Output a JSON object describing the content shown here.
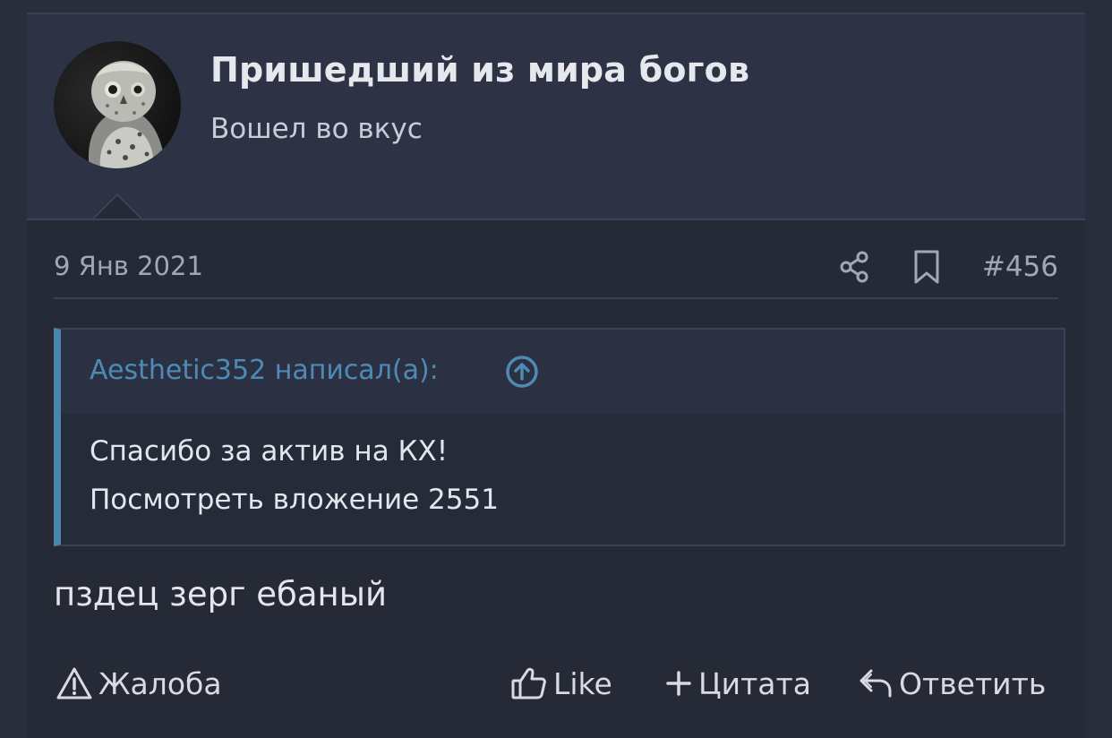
{
  "user": {
    "name": "Пришедший из мира богов",
    "title": "Вошел во вкус"
  },
  "post": {
    "date": "9 Янв 2021",
    "number": "#456",
    "quote": {
      "author": "Aesthetic352 написал(а):",
      "lines": [
        "Спасибо за актив на КХ!",
        "Посмотреть вложение 2551"
      ]
    },
    "message": "пздец зерг ебаный"
  },
  "actions": {
    "report": "Жалоба",
    "like": "Like",
    "quote": "Цитата",
    "reply": "Ответить"
  },
  "icons": [
    "owl-avatar",
    "share-icon",
    "bookmark-icon",
    "arrow-up-circle-icon",
    "warning-icon",
    "thumbs-up-icon",
    "plus-icon",
    "reply-icon"
  ],
  "colors": {
    "accent": "#4e8ab4",
    "background": "#252a36",
    "header": "#2d3345"
  }
}
